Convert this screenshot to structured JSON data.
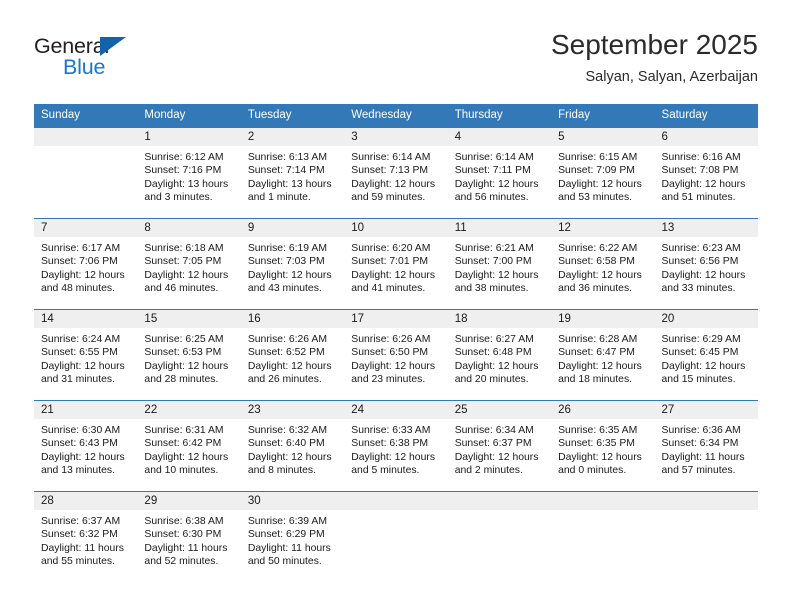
{
  "logo": {
    "word_one": "General",
    "word_two": "Blue",
    "triangle_color": "#1263ad",
    "word_two_color": "#1878cf"
  },
  "header": {
    "title": "September 2025",
    "subtitle": "Salyan, Salyan, Azerbaijan"
  },
  "theme": {
    "header_blue": "#3479b7",
    "daynum_band": "#efefef",
    "text": "#1a1a1a"
  },
  "weekday_headers": [
    "Sunday",
    "Monday",
    "Tuesday",
    "Wednesday",
    "Thursday",
    "Friday",
    "Saturday"
  ],
  "weeks": [
    [
      {
        "day": "",
        "sunrise": "",
        "sunset": "",
        "daylight_line1": "",
        "daylight_line2": ""
      },
      {
        "day": "1",
        "sunrise": "Sunrise: 6:12 AM",
        "sunset": "Sunset: 7:16 PM",
        "daylight_line1": "Daylight: 13 hours",
        "daylight_line2": "and 3 minutes."
      },
      {
        "day": "2",
        "sunrise": "Sunrise: 6:13 AM",
        "sunset": "Sunset: 7:14 PM",
        "daylight_line1": "Daylight: 13 hours",
        "daylight_line2": "and 1 minute."
      },
      {
        "day": "3",
        "sunrise": "Sunrise: 6:14 AM",
        "sunset": "Sunset: 7:13 PM",
        "daylight_line1": "Daylight: 12 hours",
        "daylight_line2": "and 59 minutes."
      },
      {
        "day": "4",
        "sunrise": "Sunrise: 6:14 AM",
        "sunset": "Sunset: 7:11 PM",
        "daylight_line1": "Daylight: 12 hours",
        "daylight_line2": "and 56 minutes."
      },
      {
        "day": "5",
        "sunrise": "Sunrise: 6:15 AM",
        "sunset": "Sunset: 7:09 PM",
        "daylight_line1": "Daylight: 12 hours",
        "daylight_line2": "and 53 minutes."
      },
      {
        "day": "6",
        "sunrise": "Sunrise: 6:16 AM",
        "sunset": "Sunset: 7:08 PM",
        "daylight_line1": "Daylight: 12 hours",
        "daylight_line2": "and 51 minutes."
      }
    ],
    [
      {
        "day": "7",
        "sunrise": "Sunrise: 6:17 AM",
        "sunset": "Sunset: 7:06 PM",
        "daylight_line1": "Daylight: 12 hours",
        "daylight_line2": "and 48 minutes."
      },
      {
        "day": "8",
        "sunrise": "Sunrise: 6:18 AM",
        "sunset": "Sunset: 7:05 PM",
        "daylight_line1": "Daylight: 12 hours",
        "daylight_line2": "and 46 minutes."
      },
      {
        "day": "9",
        "sunrise": "Sunrise: 6:19 AM",
        "sunset": "Sunset: 7:03 PM",
        "daylight_line1": "Daylight: 12 hours",
        "daylight_line2": "and 43 minutes."
      },
      {
        "day": "10",
        "sunrise": "Sunrise: 6:20 AM",
        "sunset": "Sunset: 7:01 PM",
        "daylight_line1": "Daylight: 12 hours",
        "daylight_line2": "and 41 minutes."
      },
      {
        "day": "11",
        "sunrise": "Sunrise: 6:21 AM",
        "sunset": "Sunset: 7:00 PM",
        "daylight_line1": "Daylight: 12 hours",
        "daylight_line2": "and 38 minutes."
      },
      {
        "day": "12",
        "sunrise": "Sunrise: 6:22 AM",
        "sunset": "Sunset: 6:58 PM",
        "daylight_line1": "Daylight: 12 hours",
        "daylight_line2": "and 36 minutes."
      },
      {
        "day": "13",
        "sunrise": "Sunrise: 6:23 AM",
        "sunset": "Sunset: 6:56 PM",
        "daylight_line1": "Daylight: 12 hours",
        "daylight_line2": "and 33 minutes."
      }
    ],
    [
      {
        "day": "14",
        "sunrise": "Sunrise: 6:24 AM",
        "sunset": "Sunset: 6:55 PM",
        "daylight_line1": "Daylight: 12 hours",
        "daylight_line2": "and 31 minutes."
      },
      {
        "day": "15",
        "sunrise": "Sunrise: 6:25 AM",
        "sunset": "Sunset: 6:53 PM",
        "daylight_line1": "Daylight: 12 hours",
        "daylight_line2": "and 28 minutes."
      },
      {
        "day": "16",
        "sunrise": "Sunrise: 6:26 AM",
        "sunset": "Sunset: 6:52 PM",
        "daylight_line1": "Daylight: 12 hours",
        "daylight_line2": "and 26 minutes."
      },
      {
        "day": "17",
        "sunrise": "Sunrise: 6:26 AM",
        "sunset": "Sunset: 6:50 PM",
        "daylight_line1": "Daylight: 12 hours",
        "daylight_line2": "and 23 minutes."
      },
      {
        "day": "18",
        "sunrise": "Sunrise: 6:27 AM",
        "sunset": "Sunset: 6:48 PM",
        "daylight_line1": "Daylight: 12 hours",
        "daylight_line2": "and 20 minutes."
      },
      {
        "day": "19",
        "sunrise": "Sunrise: 6:28 AM",
        "sunset": "Sunset: 6:47 PM",
        "daylight_line1": "Daylight: 12 hours",
        "daylight_line2": "and 18 minutes."
      },
      {
        "day": "20",
        "sunrise": "Sunrise: 6:29 AM",
        "sunset": "Sunset: 6:45 PM",
        "daylight_line1": "Daylight: 12 hours",
        "daylight_line2": "and 15 minutes."
      }
    ],
    [
      {
        "day": "21",
        "sunrise": "Sunrise: 6:30 AM",
        "sunset": "Sunset: 6:43 PM",
        "daylight_line1": "Daylight: 12 hours",
        "daylight_line2": "and 13 minutes."
      },
      {
        "day": "22",
        "sunrise": "Sunrise: 6:31 AM",
        "sunset": "Sunset: 6:42 PM",
        "daylight_line1": "Daylight: 12 hours",
        "daylight_line2": "and 10 minutes."
      },
      {
        "day": "23",
        "sunrise": "Sunrise: 6:32 AM",
        "sunset": "Sunset: 6:40 PM",
        "daylight_line1": "Daylight: 12 hours",
        "daylight_line2": "and 8 minutes."
      },
      {
        "day": "24",
        "sunrise": "Sunrise: 6:33 AM",
        "sunset": "Sunset: 6:38 PM",
        "daylight_line1": "Daylight: 12 hours",
        "daylight_line2": "and 5 minutes."
      },
      {
        "day": "25",
        "sunrise": "Sunrise: 6:34 AM",
        "sunset": "Sunset: 6:37 PM",
        "daylight_line1": "Daylight: 12 hours",
        "daylight_line2": "and 2 minutes."
      },
      {
        "day": "26",
        "sunrise": "Sunrise: 6:35 AM",
        "sunset": "Sunset: 6:35 PM",
        "daylight_line1": "Daylight: 12 hours",
        "daylight_line2": "and 0 minutes."
      },
      {
        "day": "27",
        "sunrise": "Sunrise: 6:36 AM",
        "sunset": "Sunset: 6:34 PM",
        "daylight_line1": "Daylight: 11 hours",
        "daylight_line2": "and 57 minutes."
      }
    ],
    [
      {
        "day": "28",
        "sunrise": "Sunrise: 6:37 AM",
        "sunset": "Sunset: 6:32 PM",
        "daylight_line1": "Daylight: 11 hours",
        "daylight_line2": "and 55 minutes."
      },
      {
        "day": "29",
        "sunrise": "Sunrise: 6:38 AM",
        "sunset": "Sunset: 6:30 PM",
        "daylight_line1": "Daylight: 11 hours",
        "daylight_line2": "and 52 minutes."
      },
      {
        "day": "30",
        "sunrise": "Sunrise: 6:39 AM",
        "sunset": "Sunset: 6:29 PM",
        "daylight_line1": "Daylight: 11 hours",
        "daylight_line2": "and 50 minutes."
      },
      {
        "day": "",
        "sunrise": "",
        "sunset": "",
        "daylight_line1": "",
        "daylight_line2": ""
      },
      {
        "day": "",
        "sunrise": "",
        "sunset": "",
        "daylight_line1": "",
        "daylight_line2": ""
      },
      {
        "day": "",
        "sunrise": "",
        "sunset": "",
        "daylight_line1": "",
        "daylight_line2": ""
      },
      {
        "day": "",
        "sunrise": "",
        "sunset": "",
        "daylight_line1": "",
        "daylight_line2": ""
      }
    ]
  ]
}
